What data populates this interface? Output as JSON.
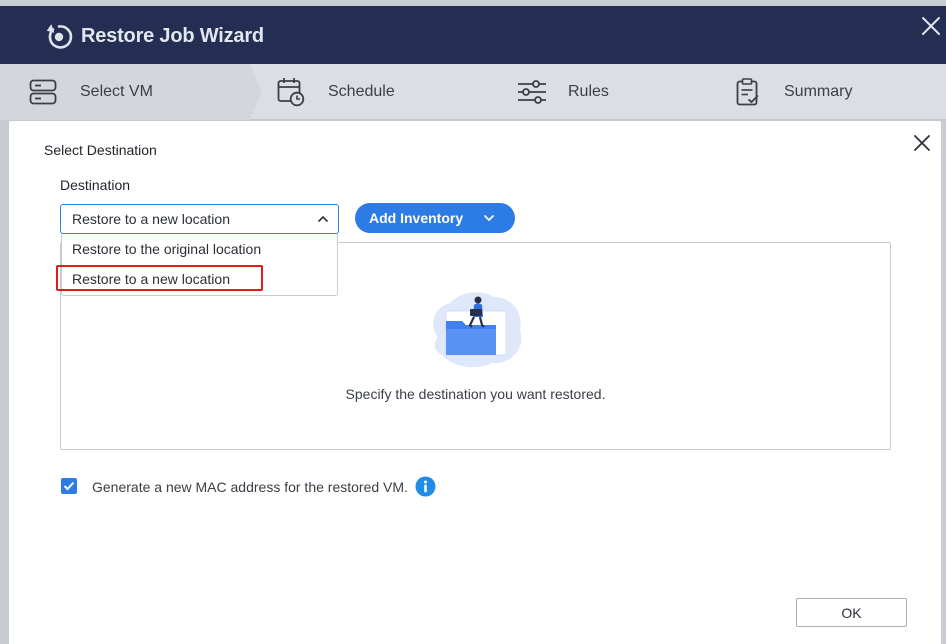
{
  "wizard": {
    "title": "Restore Job Wizard",
    "icons": {
      "title": "restore-icon",
      "close": "close-icon"
    }
  },
  "steps": [
    {
      "label": "Select VM",
      "icon": "server-icon",
      "active": true
    },
    {
      "label": "Schedule",
      "icon": "calendar-clock-icon",
      "active": false
    },
    {
      "label": "Rules",
      "icon": "sliders-icon",
      "active": false
    },
    {
      "label": "Summary",
      "icon": "clipboard-check-icon",
      "active": false
    }
  ],
  "dialog": {
    "title": "Select Destination",
    "destination": {
      "label": "Destination",
      "selected": "Restore to a new location",
      "options": [
        "Restore to the original location",
        "Restore to a new location"
      ]
    },
    "add_inventory_label": "Add Inventory",
    "empty_text": "Specify the destination you want restored.",
    "mac_option": {
      "label": "Generate a new MAC address for the restored VM.",
      "checked": true
    },
    "ok_label": "OK"
  },
  "colors": {
    "header": "#232e52",
    "accent": "#2d7be4",
    "highlight": "#e21b1b"
  }
}
